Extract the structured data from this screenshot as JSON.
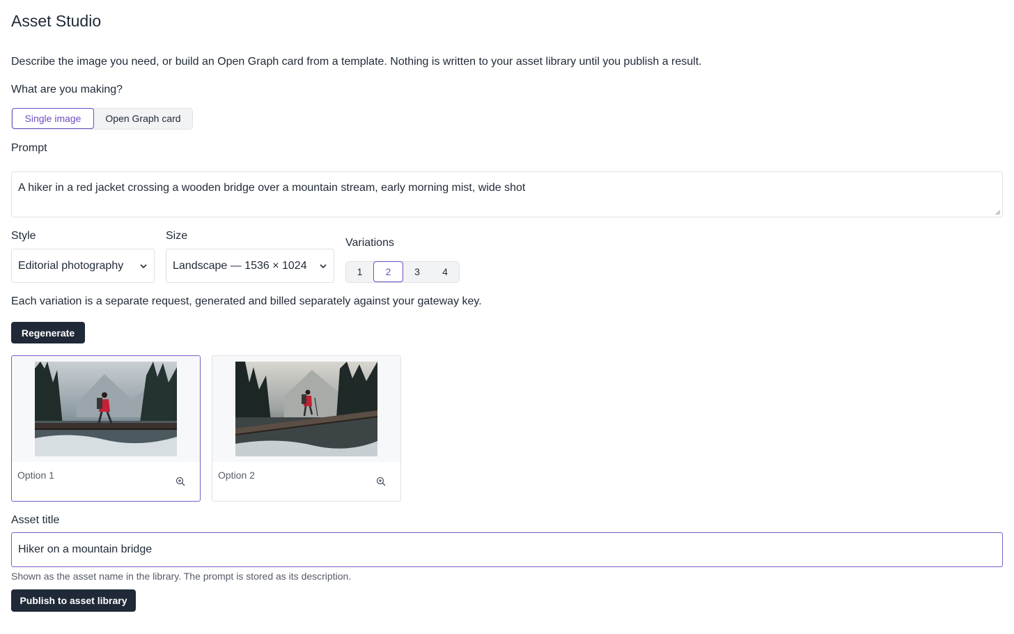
{
  "header": {
    "title": "Asset Studio"
  },
  "intro": "Describe the image you need, or build an Open Graph card from a template. Nothing is written to your asset library until you publish a result.",
  "mode": {
    "label": "What are you making?",
    "options": [
      "Single image",
      "Open Graph card"
    ],
    "selected": "Single image"
  },
  "prompt": {
    "label": "Prompt",
    "value": "A hiker in a red jacket crossing a wooden bridge over a mountain stream, early morning mist, wide shot"
  },
  "style": {
    "label": "Style",
    "value": "Editorial photography"
  },
  "size": {
    "label": "Size",
    "value": "Landscape — 1536 × 1024"
  },
  "variations": {
    "label": "Variations",
    "options": [
      "1",
      "2",
      "3",
      "4"
    ],
    "selected": "2",
    "hint": "Each variation is a separate request, generated and billed separately against your gateway key."
  },
  "regenerate_label": "Regenerate",
  "results": [
    {
      "label": "Option 1",
      "selected": true
    },
    {
      "label": "Option 2",
      "selected": false
    }
  ],
  "asset_title": {
    "label": "Asset title",
    "value": "Hiker on a mountain bridge",
    "help": "Shown as the asset name in the library. The prompt is stored as its description."
  },
  "publish_label": "Publish to asset library",
  "colors": {
    "accent": "#6d4fc2",
    "dark_button": "#1f2937",
    "border": "#dfe1e5"
  }
}
